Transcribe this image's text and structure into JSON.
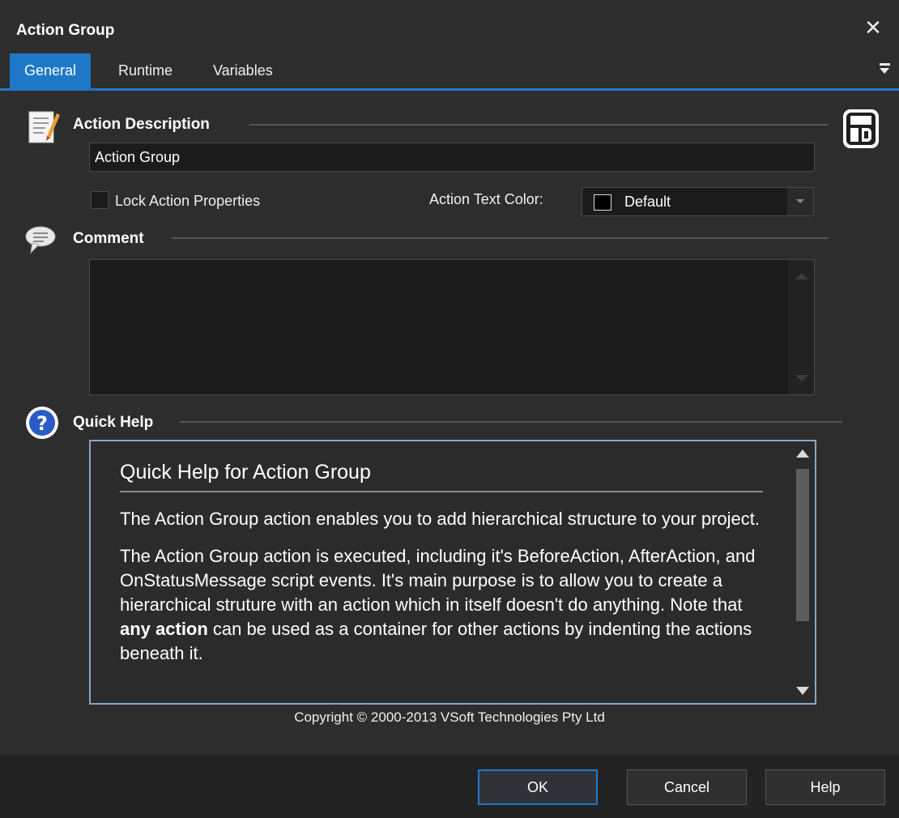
{
  "window": {
    "title": "Action Group"
  },
  "tabs": [
    {
      "label": "General"
    },
    {
      "label": "Runtime"
    },
    {
      "label": "Variables"
    }
  ],
  "description": {
    "label": "Action Description",
    "value": "Action Group"
  },
  "lock": {
    "label": "Lock Action Properties",
    "checked": false
  },
  "text_color": {
    "label": "Action Text Color:",
    "value": "Default",
    "swatch": "#000000"
  },
  "comment": {
    "label": "Comment",
    "value": ""
  },
  "quick_help": {
    "label": "Quick Help",
    "title": "Quick Help for Action Group",
    "p1": "The Action Group action enables you to add hierarchical structure to your project.",
    "p2_before": "The Action Group action is executed, including it's BeforeAction, AfterAction, and OnStatusMessage script events. It's main purpose is to allow you to create a hierarchical struture with an action which in itself doesn't do anything. Note that ",
    "p2_bold": "any action",
    "p2_after": " can be used as a container for other actions by indenting the actions beneath it."
  },
  "copyright": "Copyright © 2000-2013 VSoft Technologies Pty Ltd",
  "buttons": {
    "ok": "OK",
    "cancel": "Cancel",
    "help": "Help"
  },
  "colors": {
    "accent": "#1e78c8",
    "background": "#2d2d2d",
    "field": "#1b1b1b"
  }
}
